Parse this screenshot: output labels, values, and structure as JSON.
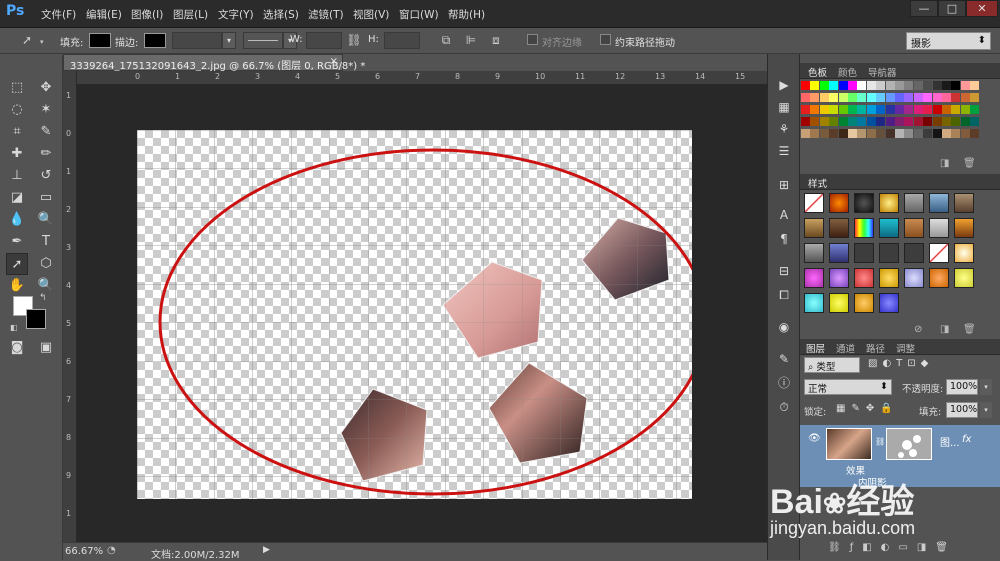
{
  "app": {
    "logo": "Ps"
  },
  "menu": [
    "文件(F)",
    "编辑(E)",
    "图像(I)",
    "图层(L)",
    "文字(Y)",
    "选择(S)",
    "滤镜(T)",
    "视图(V)",
    "窗口(W)",
    "帮助(H)"
  ],
  "window_buttons": {
    "minimize": "—",
    "restore": "□",
    "close": "✕"
  },
  "options": {
    "fill_label": "填充:",
    "stroke_label": "描边:",
    "w_label": "W:",
    "h_label": "H:",
    "align_edges": "对齐边缘",
    "constrain_path": "约束路径拖动",
    "workspace": "摄影"
  },
  "document": {
    "tab_title": "3339264_175132091643_2.jpg @ 66.7% (图层 0, RGB/8*) *",
    "close": "×",
    "ruler_h": [
      "0",
      "1",
      "2",
      "3",
      "4",
      "5",
      "6",
      "7",
      "8",
      "9",
      "10",
      "11",
      "12",
      "13",
      "14",
      "15"
    ],
    "ruler_v": [
      "1",
      "0",
      "1",
      "2",
      "3",
      "4",
      "5",
      "6",
      "7",
      "8",
      "9",
      "1"
    ]
  },
  "status": {
    "zoom": "66.67%",
    "doc_info": "文档:2.00M/2.32M"
  },
  "panels": {
    "swatches_tabs": [
      "色板",
      "颜色",
      "导航器"
    ],
    "styles_tab": "样式",
    "layers_tabs": [
      "图层",
      "通道",
      "路径",
      "调整"
    ],
    "kind": "类型",
    "blend_mode": "正常",
    "opacity_label": "不透明度:",
    "opacity_value": "100%",
    "lock_label": "锁定:",
    "fill_label": "填充:",
    "fill_value": "100%",
    "layer_name": "图...",
    "fx": "fx",
    "effects": "效果",
    "shadow": "内阴影"
  },
  "watermark": {
    "brand": "Bai",
    "brand2": "经验",
    "url": "jingyan.baidu.com"
  },
  "colors": {
    "ellipse": "#cc1111",
    "accent": "#4fa8ff",
    "layer_selected": "#6d8fb5"
  }
}
